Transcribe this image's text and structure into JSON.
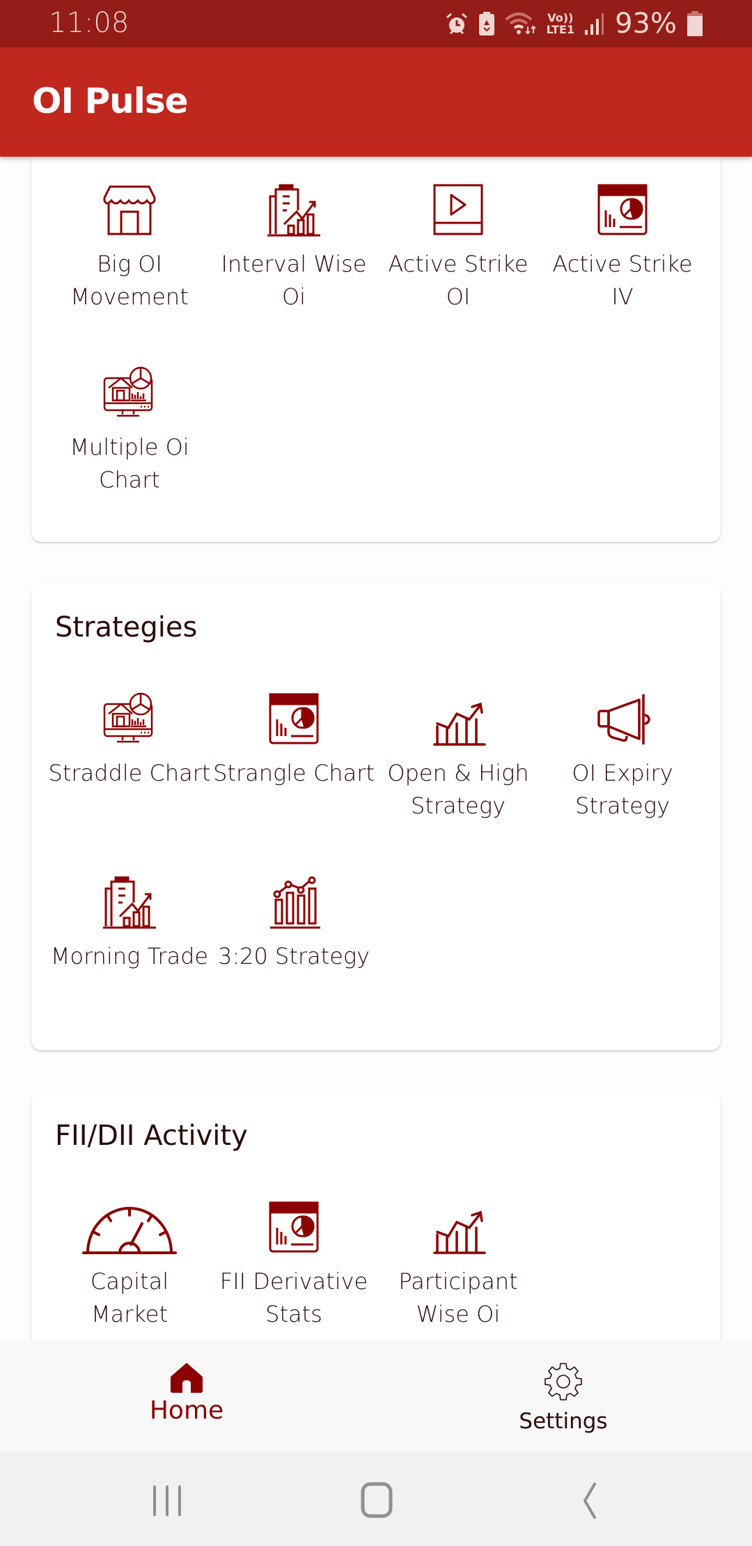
{
  "status_bar": {
    "time": "11:08",
    "icons": [
      "alarm-icon",
      "battery-saver-icon",
      "wifi-icon",
      "volte-lte-icon",
      "signal-icon",
      "battery-icon"
    ],
    "network_label_top": "Vo))",
    "network_label_bottom": "LTE1",
    "battery_percent": "93%"
  },
  "app_bar": {
    "title": "OI Pulse"
  },
  "colors": {
    "status_bar": "#951d17",
    "app_bar": "#c0281e",
    "accent": "#8b0000",
    "text": "#2a0b0b"
  },
  "sections": [
    {
      "title": "",
      "items": [
        {
          "line1": "Big OI",
          "line2": "Movement",
          "icon": "storefront-icon"
        },
        {
          "line1": "Interval Wise",
          "line2": "Oi",
          "icon": "building-growth-icon"
        },
        {
          "line1": "Active Strike",
          "line2": "OI",
          "icon": "play-video-icon"
        },
        {
          "line1": "Active Strike",
          "line2": "IV",
          "icon": "dashboard-report-icon"
        },
        {
          "line1": "Multiple Oi",
          "line2": "Chart",
          "icon": "monitor-analytics-icon"
        }
      ]
    },
    {
      "title": "Strategies",
      "items": [
        {
          "line1": "Straddle Chart",
          "line2": "",
          "icon": "monitor-analytics-icon"
        },
        {
          "line1": "Strangle Chart",
          "line2": "",
          "icon": "dashboard-report-icon"
        },
        {
          "line1": "Open & High",
          "line2": "Strategy",
          "icon": "bar-trend-up-icon"
        },
        {
          "line1": "OI Expiry",
          "line2": "Strategy",
          "icon": "megaphone-icon"
        },
        {
          "line1": "Morning Trade",
          "line2": "",
          "icon": "building-growth-icon"
        },
        {
          "line1": "3:20 Strategy",
          "line2": "",
          "icon": "bar-line-chart-icon"
        }
      ]
    },
    {
      "title": "FII/DII Activity",
      "items": [
        {
          "line1": "Capital",
          "line2": "Market",
          "icon": "speedometer-icon"
        },
        {
          "line1": "FII Derivative",
          "line2": "Stats",
          "icon": "dashboard-report-icon"
        },
        {
          "line1": "Participant",
          "line2": "Wise Oi",
          "icon": "bar-trend-up-icon"
        }
      ]
    }
  ],
  "bottom_nav": {
    "items": [
      {
        "label": "Home",
        "icon": "home-icon",
        "active": true
      },
      {
        "label": "Settings",
        "icon": "gear-icon",
        "active": false
      }
    ]
  },
  "system_nav": {
    "buttons": [
      "recent-apps-icon",
      "home-circle-icon",
      "back-icon"
    ]
  }
}
